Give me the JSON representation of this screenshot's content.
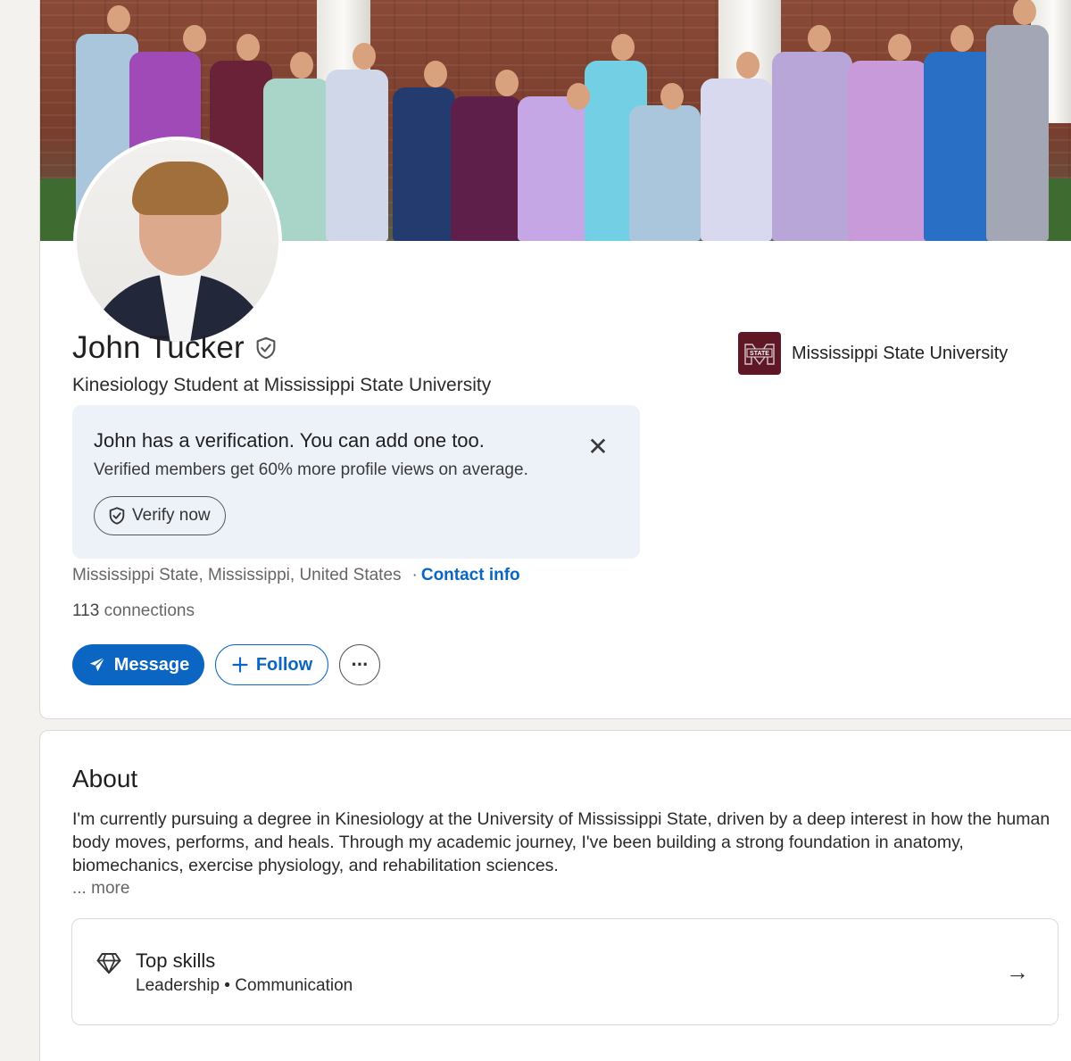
{
  "profile": {
    "name": "John Tucker",
    "headline": "Kinesiology Student at Mississippi State University",
    "school": "Mississippi State University",
    "school_logo_text": "STATE",
    "location": "Mississippi State, Mississippi, United States",
    "separator": "·",
    "contact_label": "Contact info",
    "connections_count": "113",
    "connections_label": "connections"
  },
  "verification": {
    "title": "John has a verification. You can add one too.",
    "subtitle": "Verified members get 60% more profile views on average.",
    "button_label": "Verify now",
    "close_symbol": "✕"
  },
  "actions": {
    "message_label": "Message",
    "follow_label": "Follow",
    "more_symbol": "···"
  },
  "about": {
    "title": "About",
    "text": "I'm currently pursuing a degree in Kinesiology at the University of Mississippi State, driven by a deep interest in how the human body moves, performs, and heals. Through my academic journey, I've been building a strong foundation in anatomy, biomechanics, exercise physiology, and rehabilitation sciences.",
    "more_label": "... more"
  },
  "top_skills": {
    "title": "Top skills",
    "skills": "Leadership • Communication",
    "arrow": "→"
  },
  "icons": {
    "verified": "shield-check-icon",
    "send": "paper-plane-icon",
    "plus": "plus-icon",
    "more": "ellipsis-icon",
    "close": "close-icon",
    "diamond": "diamond-icon",
    "arrow": "arrow-right-icon"
  },
  "colors": {
    "accent": "#0a66c2",
    "school_maroon": "#5d1725",
    "verify_bg": "#edf2f9"
  }
}
